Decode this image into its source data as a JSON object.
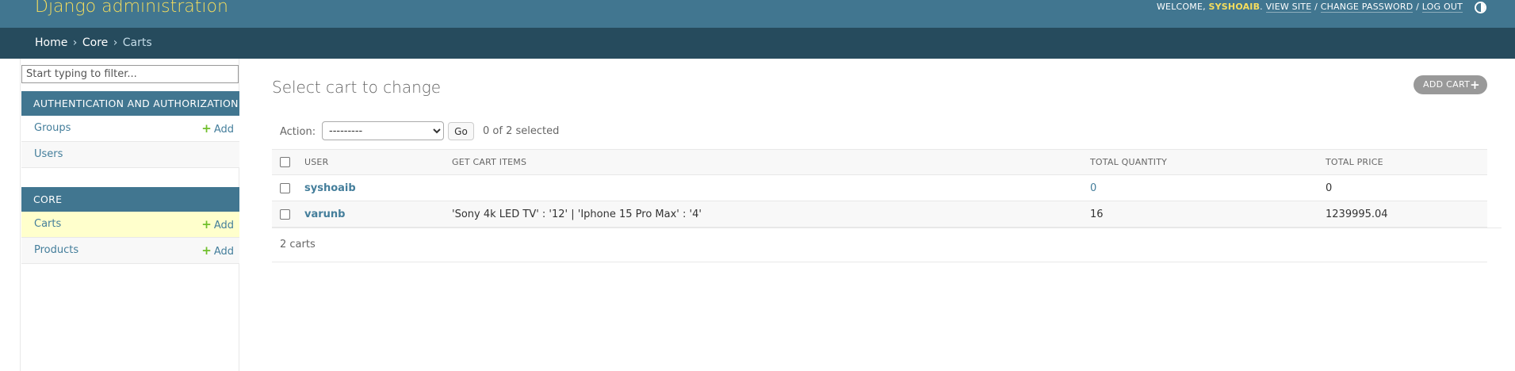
{
  "header": {
    "site_name": "Django administration",
    "welcome_prefix": "Welcome, ",
    "username": "syshoaib",
    "welcome_suffix": ".",
    "view_site": "View site",
    "change_password": "Change password",
    "log_out": "Log out",
    "separator": "/",
    "theme_icon": "contrast-half-circle-icon"
  },
  "breadcrumbs": {
    "home": "Home",
    "app": "Core",
    "current": "Carts",
    "separator": "›"
  },
  "sidebar": {
    "filter_placeholder": "Start typing to filter...",
    "modules": [
      {
        "caption": "Authentication and Authorization",
        "models": [
          {
            "name": "Groups",
            "add_label": "Add",
            "has_add": true
          },
          {
            "name": "Users",
            "add_label": "",
            "has_add": false
          }
        ]
      },
      {
        "caption": "Core",
        "models": [
          {
            "name": "Carts",
            "add_label": "Add",
            "has_add": true,
            "current": true
          },
          {
            "name": "Products",
            "add_label": "Add",
            "has_add": true
          }
        ]
      }
    ],
    "add_icon": "plus-icon"
  },
  "content": {
    "title": "Select cart to change",
    "add_button": "Add cart",
    "add_button_icon": "+",
    "actions": {
      "label": "Action:",
      "selected_option": "---------",
      "go_label": "Go",
      "counter": "0 of 2 selected"
    },
    "table": {
      "columns": [
        "User",
        "Get cart items",
        "Total quantity",
        "Total price"
      ],
      "rows": [
        {
          "user": "syshoaib",
          "items": "",
          "quantity": "0",
          "price": "0"
        },
        {
          "user": "varunb",
          "items": "'Sony 4k LED TV' : '12' | 'Iphone 15 Pro Max' : '4'",
          "quantity": "16",
          "price": "1239995.04"
        }
      ]
    },
    "paginator": "2 carts"
  },
  "colors": {
    "header_bg": "#417690",
    "breadcrumbs_bg": "#264b5d",
    "site_name": "#f5dd5d",
    "link": "#447e9b",
    "add_plus": "#70bf2b",
    "current_row": "#ffffcc"
  }
}
